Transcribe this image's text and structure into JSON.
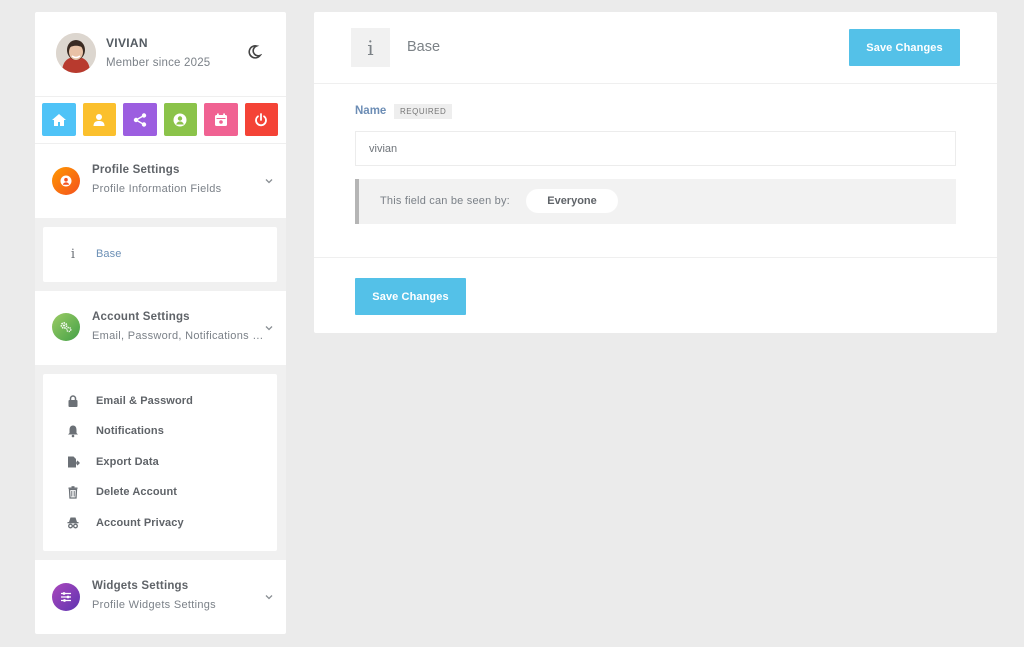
{
  "user": {
    "name": "VIVIAN",
    "member_since": "Member since 2025"
  },
  "theme_toggle": {
    "icon": "moon-icon"
  },
  "quick_actions": [
    {
      "name": "home",
      "icon": "home-icon",
      "color": "#4fc3f7"
    },
    {
      "name": "profile",
      "icon": "user-icon",
      "color": "#fbc02d"
    },
    {
      "name": "share",
      "icon": "share-icon",
      "color": "#9c5ee0"
    },
    {
      "name": "account",
      "icon": "user-circle-icon",
      "color": "#8bc34a"
    },
    {
      "name": "calendar",
      "icon": "calendar-icon",
      "color": "#f06292"
    },
    {
      "name": "logout",
      "icon": "power-icon",
      "color": "#f44336"
    }
  ],
  "sections": {
    "profile": {
      "title": "Profile Settings",
      "subtitle": "Profile Information Fields",
      "color": "#ff7043"
    },
    "account": {
      "title": "Account Settings",
      "subtitle": "Email, Password, Notifications and privacy",
      "color": "#7cb342"
    },
    "widgets": {
      "title": "Widgets Settings",
      "subtitle": "Profile Widgets Settings",
      "color": "#7e57c2"
    }
  },
  "profile_items": [
    {
      "label": "Base",
      "icon": "info-icon"
    }
  ],
  "account_items": [
    {
      "label": "Email & Password",
      "icon": "lock-icon"
    },
    {
      "label": "Notifications",
      "icon": "bell-icon"
    },
    {
      "label": "Export Data",
      "icon": "export-icon"
    },
    {
      "label": "Delete Account",
      "icon": "trash-icon"
    },
    {
      "label": "Account Privacy",
      "icon": "privacy-icon"
    }
  ],
  "main": {
    "icon_glyph": "i",
    "title": "Base",
    "save_label": "Save Changes",
    "field": {
      "label": "Name",
      "required": "REQUIRED",
      "value": "vivian",
      "visibility_text": "This field can be seen by:",
      "visibility_value": "Everyone"
    }
  },
  "colors": {
    "accent": "#54c1e8",
    "link": "#6c8db5"
  }
}
